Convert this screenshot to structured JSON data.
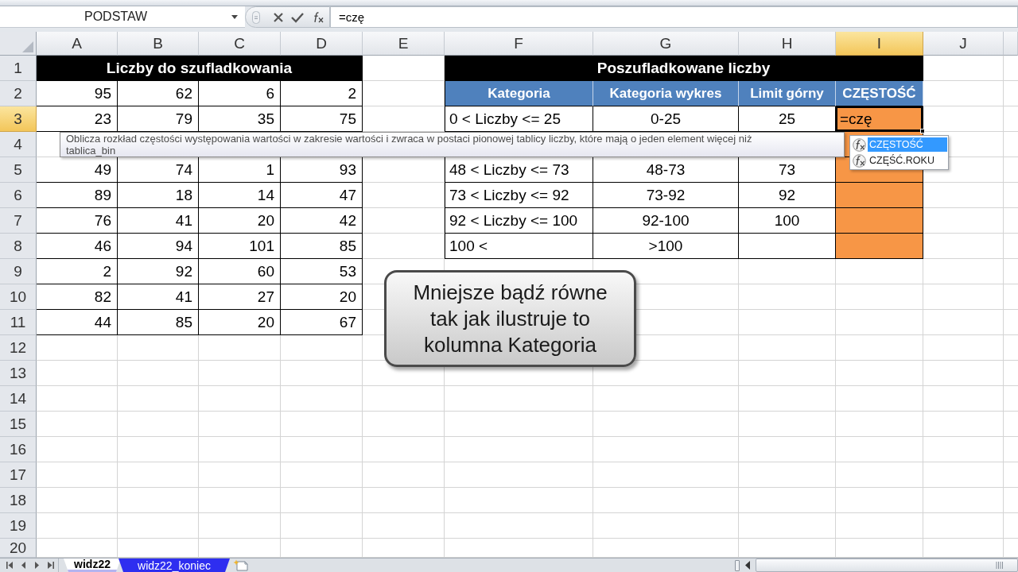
{
  "formula_bar": {
    "name_box": "PODSTAW",
    "formula": "=czę"
  },
  "sheet": {
    "columns": [
      {
        "label": "A",
        "selected": false
      },
      {
        "label": "B",
        "selected": false
      },
      {
        "label": "C",
        "selected": false
      },
      {
        "label": "D",
        "selected": false
      },
      {
        "label": "E",
        "selected": false
      },
      {
        "label": "F",
        "selected": false
      },
      {
        "label": "G",
        "selected": false
      },
      {
        "label": "H",
        "selected": false
      },
      {
        "label": "I",
        "selected": true
      },
      {
        "label": "J",
        "selected": false
      }
    ],
    "rows": [
      {
        "label": "1",
        "selected": false,
        "left_table": {
          "kind": "title",
          "text": "Liczby do szufladkowania"
        },
        "right_table": {
          "kind": "title",
          "text": "Poszufladkowane liczby"
        }
      },
      {
        "label": "2",
        "selected": false,
        "left_table": {
          "kind": "data",
          "values": [
            "95",
            "62",
            "6",
            "2"
          ]
        },
        "right_table": {
          "kind": "header",
          "values": [
            "Kategoria",
            "Kategoria wykres",
            "Limit górny",
            "CZĘSTOŚĆ"
          ]
        }
      },
      {
        "label": "3",
        "selected": true,
        "left_table": {
          "kind": "data",
          "values": [
            "23",
            "79",
            "35",
            "75"
          ]
        },
        "right_table": {
          "kind": "data",
          "values": [
            "0 < Liczby <= 25",
            "0-25",
            "25",
            "=czę"
          ]
        }
      },
      {
        "label": "4",
        "selected": false,
        "left_table": {
          "kind": "blank"
        },
        "right_table": {
          "kind": "blank"
        }
      },
      {
        "label": "5",
        "selected": false,
        "left_table": {
          "kind": "data",
          "values": [
            "49",
            "74",
            "1",
            "93"
          ]
        },
        "right_table": {
          "kind": "data",
          "values": [
            "48 < Liczby <= 73",
            "48-73",
            "73"
          ]
        }
      },
      {
        "label": "6",
        "selected": false,
        "left_table": {
          "kind": "data",
          "values": [
            "89",
            "18",
            "14",
            "47"
          ]
        },
        "right_table": {
          "kind": "data",
          "values": [
            "73 < Liczby <= 92",
            "73-92",
            "92"
          ]
        }
      },
      {
        "label": "7",
        "selected": false,
        "left_table": {
          "kind": "data",
          "values": [
            "76",
            "41",
            "20",
            "42"
          ]
        },
        "right_table": {
          "kind": "data",
          "values": [
            "92 < Liczby <= 100",
            "92-100",
            "100"
          ]
        }
      },
      {
        "label": "8",
        "selected": false,
        "left_table": {
          "kind": "data",
          "values": [
            "46",
            "94",
            "101",
            "85"
          ]
        },
        "right_table": {
          "kind": "data",
          "values": [
            "100 <",
            ">100"
          ]
        }
      },
      {
        "label": "9",
        "selected": false,
        "left_table": {
          "kind": "data",
          "values": [
            "2",
            "92",
            "60",
            "53"
          ]
        }
      },
      {
        "label": "10",
        "selected": false,
        "left_table": {
          "kind": "data",
          "values": [
            "82",
            "41",
            "27",
            "20"
          ]
        }
      },
      {
        "label": "11",
        "selected": false,
        "left_table": {
          "kind": "data",
          "values": [
            "44",
            "85",
            "20",
            "67"
          ]
        }
      },
      {
        "label": "12",
        "selected": false
      },
      {
        "label": "13",
        "selected": false
      },
      {
        "label": "14",
        "selected": false
      },
      {
        "label": "15",
        "selected": false
      },
      {
        "label": "16",
        "selected": false
      },
      {
        "label": "17",
        "selected": false
      },
      {
        "label": "18",
        "selected": false
      },
      {
        "label": "19",
        "selected": false
      },
      {
        "label": "20",
        "selected": false
      }
    ]
  },
  "tooltip": {
    "text": "Oblicza rozkład częstości występowania wartości w zakresie wartości i zwraca w postaci pionowej tablicy liczby, które mają o jeden element więcej niż\ntablica_bin"
  },
  "autocomplete": {
    "items": [
      {
        "label": "CZĘSTOŚĆ",
        "selected": true
      },
      {
        "label": "CZĘŚĆ.ROKU",
        "selected": false
      }
    ]
  },
  "callout": {
    "text": "Mniejsze bądź równe tak jak ilustruje to kolumna Kategoria"
  },
  "sheet_tabs": [
    {
      "label": "widz22",
      "selected": true,
      "color": "#b4b4f0"
    },
    {
      "label": "widz22_koniec",
      "selected": false,
      "color": "#2e2ef0"
    }
  ]
}
